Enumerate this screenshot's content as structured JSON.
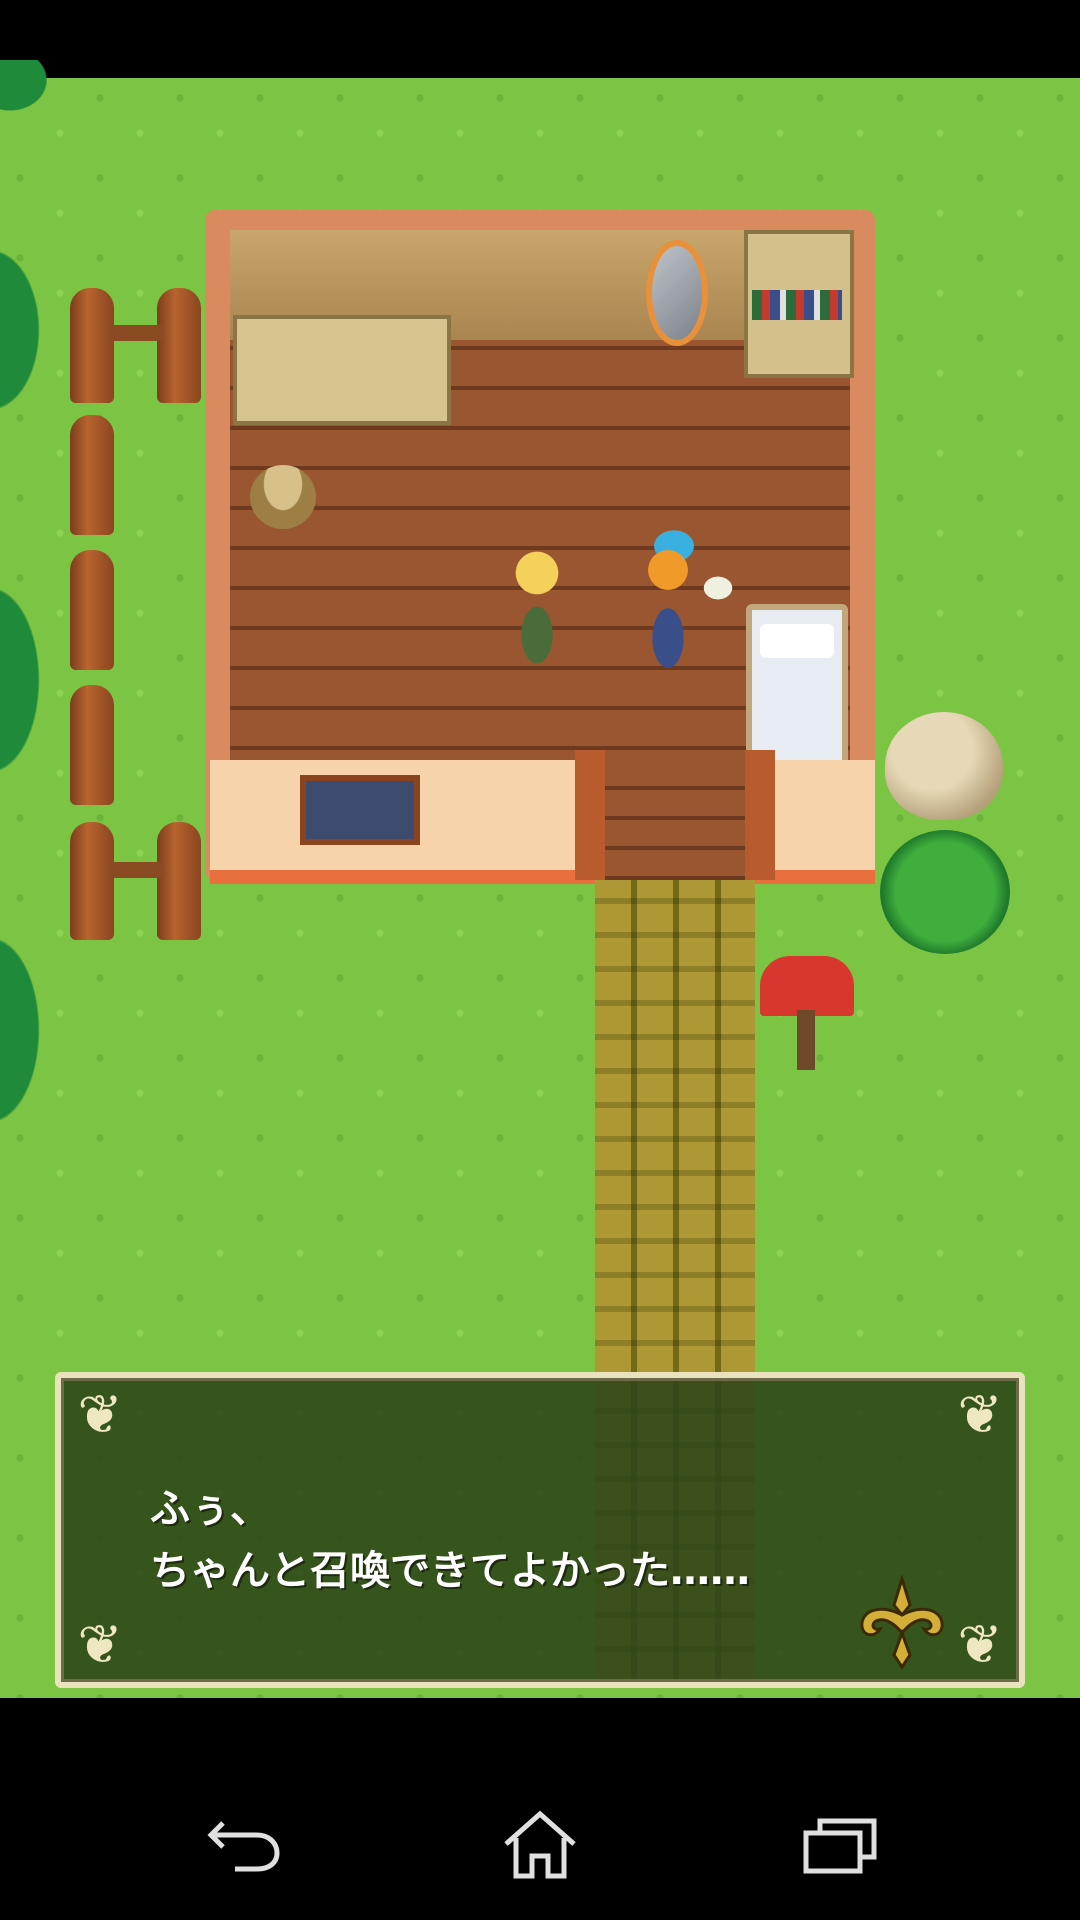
{
  "dialog": {
    "line1": "ふぅ、",
    "line2": "ちゃんと召喚できてよかった……"
  },
  "icons": {
    "next": "fleur-arrow-icon",
    "back": "back-icon",
    "home": "home-icon",
    "recents": "recents-icon"
  },
  "colors": {
    "grass": "#7cc443",
    "dialog_bg": "#2c4618",
    "dialog_border": "#e9e2bd",
    "indicator": "#c9a227"
  }
}
